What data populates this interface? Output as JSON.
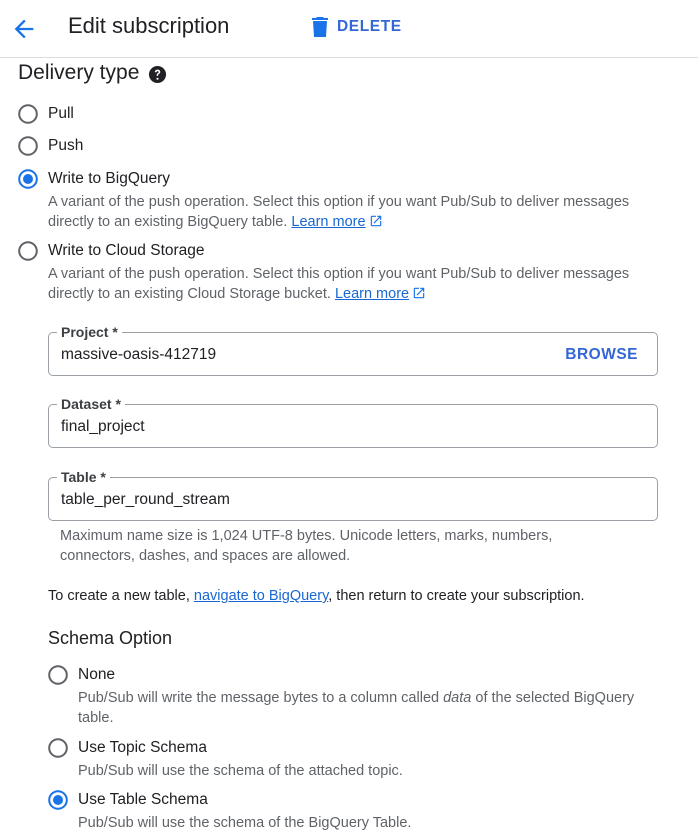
{
  "header": {
    "title": "Edit subscription",
    "delete_label": "DELETE"
  },
  "delivery": {
    "title": "Delivery type",
    "options": [
      {
        "label": "Pull",
        "selected": false
      },
      {
        "label": "Push",
        "selected": false
      },
      {
        "label": "Write to BigQuery",
        "selected": true,
        "desc_line1": "A variant of the push operation. Select this option if you want Pub/Sub to deliver messages",
        "desc_line2": "directly to an existing BigQuery table.",
        "learn_more": "Learn more"
      },
      {
        "label": "Write to Cloud Storage",
        "selected": false,
        "desc_line1": "A variant of the push operation. Select this option if you want Pub/Sub to deliver messages",
        "desc_line2": "directly to an existing Cloud Storage bucket.",
        "learn_more": "Learn more"
      }
    ]
  },
  "fields": {
    "project": {
      "label": "Project *",
      "value": "massive-oasis-412719",
      "browse": "BROWSE"
    },
    "dataset": {
      "label": "Dataset *",
      "value": "final_project"
    },
    "table": {
      "label": "Table *",
      "value": "table_per_round_stream"
    }
  },
  "hint": {
    "line1": "Maximum name size is 1,024 UTF-8 bytes. Unicode letters, marks, numbers,",
    "line2": "connectors, dashes, and spaces are allowed."
  },
  "info": {
    "before": "To create a new table,",
    "link": "navigate to BigQuery",
    "after": ", then return to create your subscription."
  },
  "schema": {
    "title": "Schema Option",
    "options": [
      {
        "label": "None",
        "selected": false,
        "desc_before": "Pub/Sub will write the message bytes to a column called",
        "desc_em": "data",
        "desc_after": "of the selected BigQuery",
        "desc_line2": "table."
      },
      {
        "label": "Use Topic Schema",
        "selected": false,
        "desc": "Pub/Sub will use the schema of the attached topic."
      },
      {
        "label": "Use Table Schema",
        "selected": true,
        "desc": "Pub/Sub will use the schema of the BigQuery Table."
      }
    ]
  },
  "colors": {
    "accent": "#1a73e8",
    "text": "#202124",
    "secondary_text": "#5f6368",
    "border": "#9aa0a6"
  }
}
